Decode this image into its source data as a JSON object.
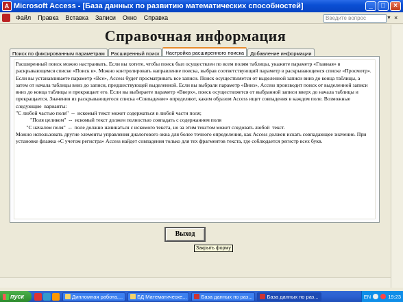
{
  "window": {
    "title": "Microsoft Access - [База данных по развитию математических способностей]",
    "app_icon": "A",
    "controls": [
      "_",
      "□",
      "×"
    ]
  },
  "menu": {
    "items": [
      "Файл",
      "Правка",
      "Вставка",
      "Записи",
      "Окно",
      "Справка"
    ],
    "ask_placeholder": "Введите вопрос",
    "ask_arrow": "▼",
    "doc_close": "×"
  },
  "form": {
    "title": "Справочная информация",
    "tabs": [
      {
        "label": "Поиск по фиксированным параметрам",
        "active": false
      },
      {
        "label": "Расширенный поиск",
        "active": false
      },
      {
        "label": "Настройка расширенного поиска",
        "active": true
      },
      {
        "label": "Добавление информации",
        "active": false
      }
    ],
    "body_text": "Расширенный поиск можно настраивать. Если вы хотите, чтобы поиск был осуществлен по всем полям таблицы, укажите параметр «Главная» в раскрывающемся списке «Поиск в». Можно контролировать направление поиска, выбрав соответствующий параметр в раскрывающемся списке «Просмотр». Если вы устанавливаете параметр «Все», Access будет просматривать все записи. Поиск осуществляется от выделенной записи вниз до конца таблицы, а затем от начала таблицы вниз до записи, предшествующей выделенной. Если вы выбрали параметр «Вниз», Access производит поиск от выделенной записи вниз до конца таблицы и прекращает его. Если вы выбираете параметр «Вверх», поиск осуществляется от выбранной записи вверх до начала таблицы и прекращается. Значения из раскрывающегося списка «Совпадение» определяют, каким образом Access ищет совпадения в каждом поле. Возможные следующие  варианты:\n\"С любой частью поля\"  --  искомый текст может содержаться в любой части поля;\n           \"Поля целиком\"  --  искомый текст должен полностью совпадать с содержанием поля\n        \"С началом поля\"  --  поле должно начинаться с искомого текста, но за этим текстом может следовать любой  текст.\nМожно использовать другие элементы управления диалогового окна для более точного определения, как Access должен искать совпадающее значение. При установке флажка «С учетом регистра» Access найдет совпадения только для тех фрагментов текста, где соблюдается регистр всех букв.",
    "exit_button": "Выход",
    "tooltip": "Закрыть форму"
  },
  "taskbar": {
    "start_label": "пуск",
    "tasks": [
      {
        "label": "Дипломная работа....",
        "active": false
      },
      {
        "label": "БД Математическе...",
        "active": false
      },
      {
        "label": "База данных по раз...",
        "active": false
      },
      {
        "label": "База данных по раз...",
        "active": true
      }
    ],
    "lang": "EN",
    "clock": "19:23"
  }
}
